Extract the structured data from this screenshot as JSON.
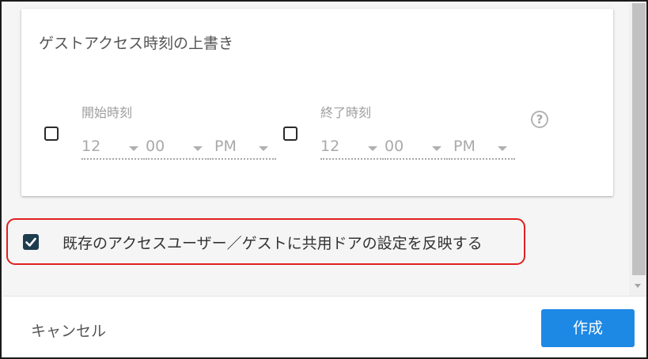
{
  "dialog": {
    "override_section": {
      "title": "ゲストアクセス時刻の上書き",
      "start": {
        "label": "開始時刻",
        "hour": "12",
        "minute": "00",
        "ampm": "PM",
        "checked": false
      },
      "end": {
        "label": "終了時刻",
        "hour": "12",
        "minute": "00",
        "ampm": "PM",
        "checked": false
      },
      "help_icon": "question-circle-icon",
      "help_glyph": "?"
    },
    "apply_option": {
      "label": "既存のアクセスユーザー／ゲストに共用ドアの設定を反映する",
      "checked": true
    },
    "footer": {
      "cancel_label": "キャンセル",
      "create_label": "作成"
    }
  },
  "colors": {
    "primary_button": "#1e88e5",
    "checkbox_checked": "#1d3d4f",
    "highlight_border": "#e02020"
  }
}
